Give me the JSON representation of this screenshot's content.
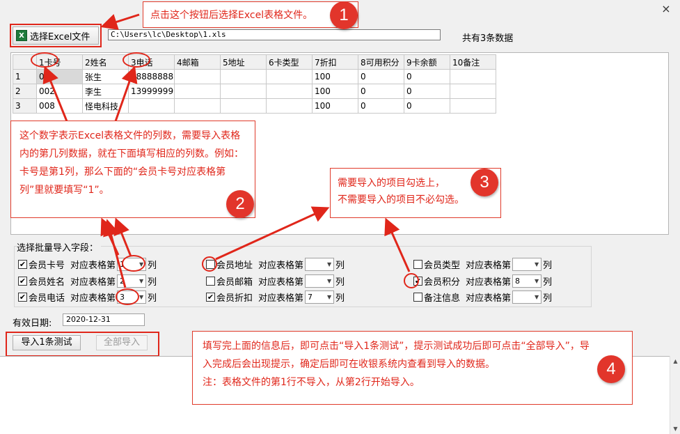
{
  "window": {
    "close_label": "×"
  },
  "toolbar": {
    "select_button": "选择Excel文件",
    "file_path": "C:\\Users\\lc\\Desktop\\1.xls",
    "count_text": "共有3条数据"
  },
  "grid": {
    "headers": [
      "",
      "1卡号",
      "2姓名",
      "3电话",
      "4邮箱",
      "5地址",
      "6卡类型",
      "7折扣",
      "8可用积分",
      "9卡余额",
      "10备注"
    ],
    "rows": [
      [
        "1",
        "001",
        "张生",
        "18888888888",
        "",
        "",
        "",
        "100",
        "0",
        "0",
        ""
      ],
      [
        "2",
        "002",
        "李生",
        "13999999999",
        "",
        "",
        "",
        "100",
        "0",
        "0",
        ""
      ],
      [
        "3",
        "008",
        "怪电科技",
        "",
        "",
        "",
        "",
        "100",
        "0",
        "0",
        ""
      ]
    ]
  },
  "fields": {
    "title": "选择批量导入字段：",
    "col_prefix": "对应表格第",
    "col_suffix": "列",
    "items": [
      {
        "label": "会员卡号",
        "checked": true,
        "value": "1"
      },
      {
        "label": "会员姓名",
        "checked": true,
        "value": "2"
      },
      {
        "label": "会员电话",
        "checked": true,
        "value": "3"
      },
      {
        "label": "会员地址",
        "checked": false,
        "value": ""
      },
      {
        "label": "会员邮箱",
        "checked": false,
        "value": ""
      },
      {
        "label": "会员折扣",
        "checked": true,
        "value": "7"
      },
      {
        "label": "会员类型",
        "checked": false,
        "value": ""
      },
      {
        "label": "会员积分",
        "checked": true,
        "value": "8"
      },
      {
        "label": "备注信息",
        "checked": false,
        "value": ""
      }
    ]
  },
  "expiry": {
    "label": "有效日期:",
    "value": "2020-12-31"
  },
  "actions": {
    "test_button": "导入1条测试",
    "import_all_button": "全部导入"
  },
  "callouts": {
    "c1": {
      "text": "点击这个按钮后选择Excel表格文件。",
      "num": "1"
    },
    "c2": {
      "text": "这个数字表示Excel表格文件的列数，需要导入表格内的第几列数据，就在下面填写相应的列数。例如：卡号是第1列，那么下面的“会员卡号对应表格第 列”里就要填写“1”。",
      "num": "2"
    },
    "c3": {
      "line1": "需要导入的项目勾选上，",
      "line2": "不需要导入的项目不必勾选。",
      "num": "3"
    },
    "c4": {
      "line1": "填写完上面的信息后，即可点击“导入1条测试”，提示测试成功后即可点击“全部导入”，导入完成后会出现提示，确定后即可在收银系统内查看到导入的数据。",
      "line2": "注：表格文件的第1行不导入，从第2行开始导入。",
      "num": "4"
    }
  },
  "colors": {
    "accent_red": "#e0261a",
    "badge_red": "#e2352b"
  }
}
